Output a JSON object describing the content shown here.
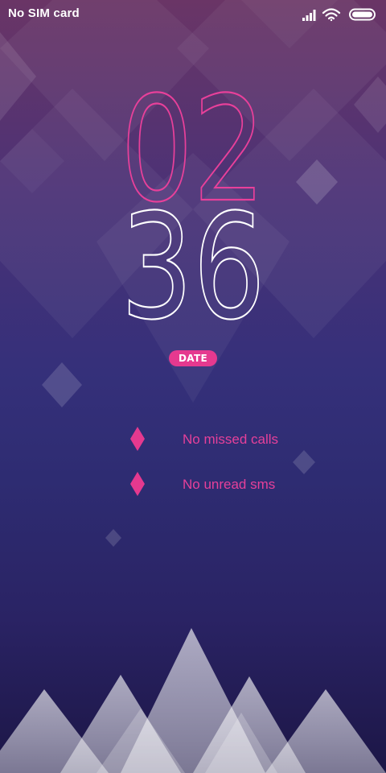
{
  "status_bar": {
    "carrier_text": "No SIM card",
    "icons": [
      "signal-icon",
      "wifi-icon",
      "battery-icon"
    ]
  },
  "clock": {
    "hour": "02",
    "minute": "36",
    "hour_color": "#e8409a",
    "minute_color": "#ffffff"
  },
  "date_badge": {
    "label": "DATE"
  },
  "notifications": [
    {
      "icon": "diamond-icon",
      "text": "No missed calls"
    },
    {
      "icon": "diamond-icon",
      "text": "No unread sms"
    }
  ],
  "colors": {
    "accent": "#e5398f",
    "background_top": "#6a3566",
    "background_mid": "#35307a",
    "background_bottom": "#1c1646"
  }
}
